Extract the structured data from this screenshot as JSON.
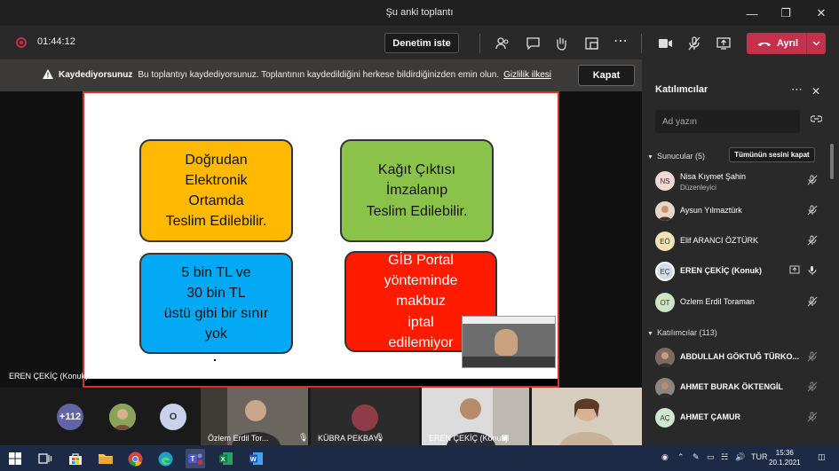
{
  "window": {
    "title": "Şu anki toplantı"
  },
  "toolbar": {
    "timer": "01:44:12",
    "review_label": "Denetim iste",
    "leave_label": "Ayrıl"
  },
  "banner": {
    "heading": "Kaydediyorsunuz",
    "message": "Bu toplantıyı kaydediyorsunuz. Toplantının kaydedildiğini herkese bildirdiğinizden emin olun.",
    "policy_link": "Gizlilik ilkesi",
    "close_label": "Kapat"
  },
  "slide": {
    "orange_lines": [
      "Doğrudan",
      "Elektronik",
      "Ortamda",
      "Teslim  Edilebilir."
    ],
    "green_lines": [
      "Kağıt Çıktısı",
      "İmzalanıp",
      "Teslim  Edilebilir."
    ],
    "blue_lines": [
      "5 bin TL ve",
      "30 bin TL",
      "üstü gibi bir sınır",
      "yok"
    ],
    "red_lines": [
      "GİB Portal",
      "yönteminde",
      "makbuz",
      "iptal",
      "edilemiyor"
    ]
  },
  "stage": {
    "presenter_name": "EREN ÇEKİÇ (Konuk)"
  },
  "gallery": {
    "overflow_count": "+112",
    "initial": "O",
    "tiles": [
      {
        "name": "Özlem Erdil Tor..."
      },
      {
        "name": "KÜBRA PEKBAY"
      },
      {
        "name": "EREN ÇEKİÇ (Konuk)"
      }
    ]
  },
  "panel": {
    "title": "Katılımcılar",
    "search_placeholder": "Ad yazın",
    "presenters_header": "Sunucular (5)",
    "mute_all_label": "Tümünün sesini kapat",
    "attendees_header": "Katılımcılar (113)",
    "presenters": [
      {
        "initials": "NS",
        "name": "Nisa Kıymet Şahin",
        "role": "Düzenleyici",
        "color": "#f3d6d6"
      },
      {
        "initials": "",
        "name": "Aysun Yılmaztürk",
        "role": "",
        "color": "#d9b8a0"
      },
      {
        "initials": "EÖ",
        "name": "Elif ARANCI ÖZTÜRK",
        "role": "",
        "color": "#f3e2b3"
      },
      {
        "initials": "EÇ",
        "name": "EREN ÇEKİÇ (Konuk)",
        "role": "",
        "color": "#d6dbe8"
      },
      {
        "initials": "OT",
        "name": "Ozlem Erdil Toraman",
        "role": "",
        "color": "#cfe3c5"
      }
    ],
    "attendees": [
      {
        "initials": "",
        "name": "ABDULLAH GÖKTUĞ TÜRKO...",
        "color": "#8a6a5a"
      },
      {
        "initials": "",
        "name": "AHMET BURAK ÖKTENGİL",
        "color": "#7a6a66"
      },
      {
        "initials": "AÇ",
        "name": "AHMET ÇAMUR",
        "color": "#cfe8cf"
      }
    ]
  },
  "taskbar": {
    "tray_lang": "TUR",
    "time": "15:36",
    "date": "20.1.2021"
  }
}
